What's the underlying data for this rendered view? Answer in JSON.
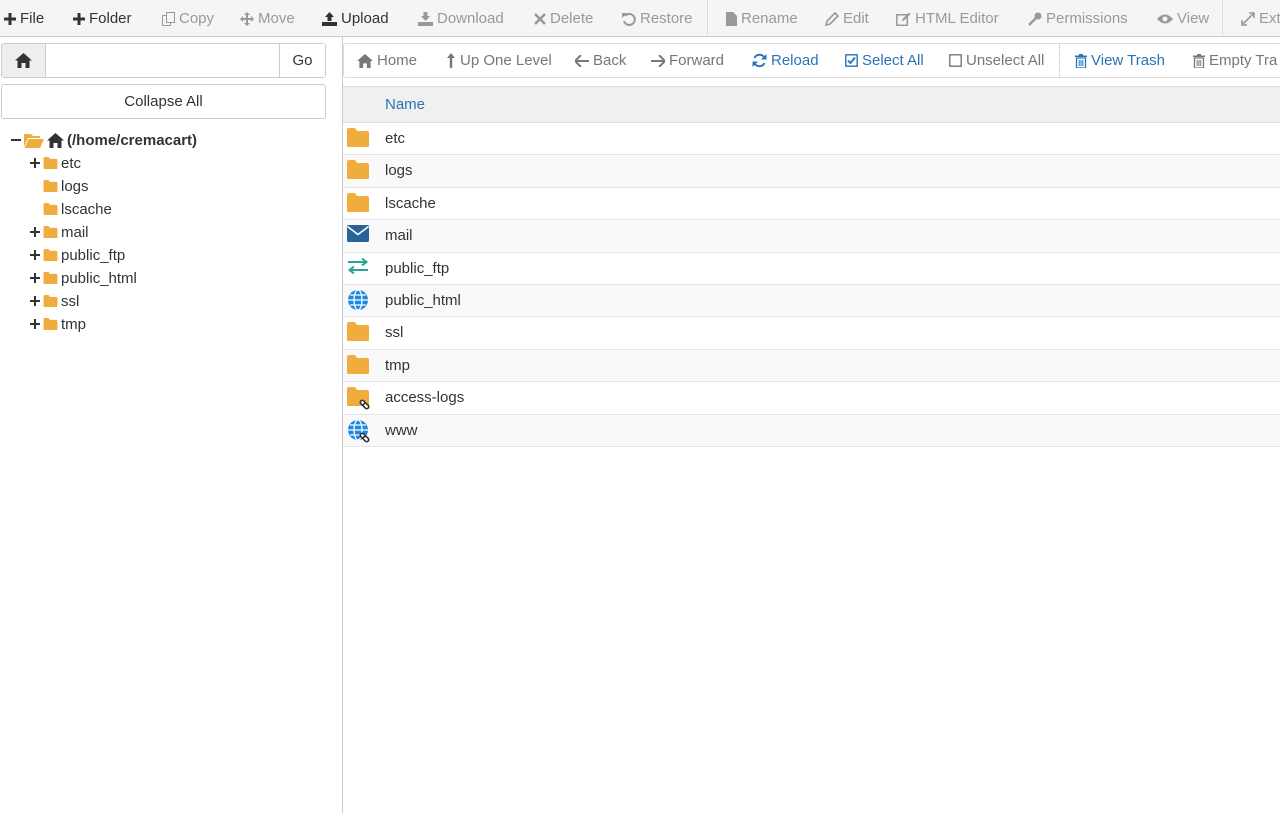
{
  "toolbar": {
    "file": "File",
    "folder": "Folder",
    "copy": "Copy",
    "move": "Move",
    "upload": "Upload",
    "download": "Download",
    "delete": "Delete",
    "restore": "Restore",
    "rename": "Rename",
    "edit": "Edit",
    "html_editor": "HTML Editor",
    "permissions": "Permissions",
    "view": "View",
    "extract": "Ext"
  },
  "pathbar": {
    "value": "",
    "go": "Go"
  },
  "collapse_all": "Collapse All",
  "tree": {
    "root": "(/home/cremacart)",
    "items": [
      {
        "label": "etc",
        "expandable": true
      },
      {
        "label": "logs",
        "expandable": false
      },
      {
        "label": "lscache",
        "expandable": false
      },
      {
        "label": "mail",
        "expandable": true
      },
      {
        "label": "public_ftp",
        "expandable": true
      },
      {
        "label": "public_html",
        "expandable": true
      },
      {
        "label": "ssl",
        "expandable": true
      },
      {
        "label": "tmp",
        "expandable": true
      }
    ]
  },
  "nav": {
    "home": "Home",
    "up": "Up One Level",
    "back": "Back",
    "forward": "Forward",
    "reload": "Reload",
    "select_all": "Select All",
    "unselect_all": "Unselect All",
    "view_trash": "View Trash",
    "empty_trash": "Empty Tra"
  },
  "table": {
    "col_name": "Name",
    "rows": [
      {
        "name": "etc",
        "icon": "folder-icon"
      },
      {
        "name": "logs",
        "icon": "folder-icon"
      },
      {
        "name": "lscache",
        "icon": "folder-icon"
      },
      {
        "name": "mail",
        "icon": "mail-icon"
      },
      {
        "name": "public_ftp",
        "icon": "exchange-arrows-icon"
      },
      {
        "name": "public_html",
        "icon": "globe-icon"
      },
      {
        "name": "ssl",
        "icon": "folder-icon"
      },
      {
        "name": "tmp",
        "icon": "folder-icon"
      },
      {
        "name": "access-logs",
        "icon": "folder-link-icon"
      },
      {
        "name": "www",
        "icon": "globe-link-icon"
      }
    ]
  },
  "colors": {
    "folder": "#f0ad3e",
    "link_blue": "#2a73b8",
    "mail": "#2a6496",
    "ftp": "#26a69a",
    "globe": "#1e88e5",
    "disabled": "#999999"
  }
}
